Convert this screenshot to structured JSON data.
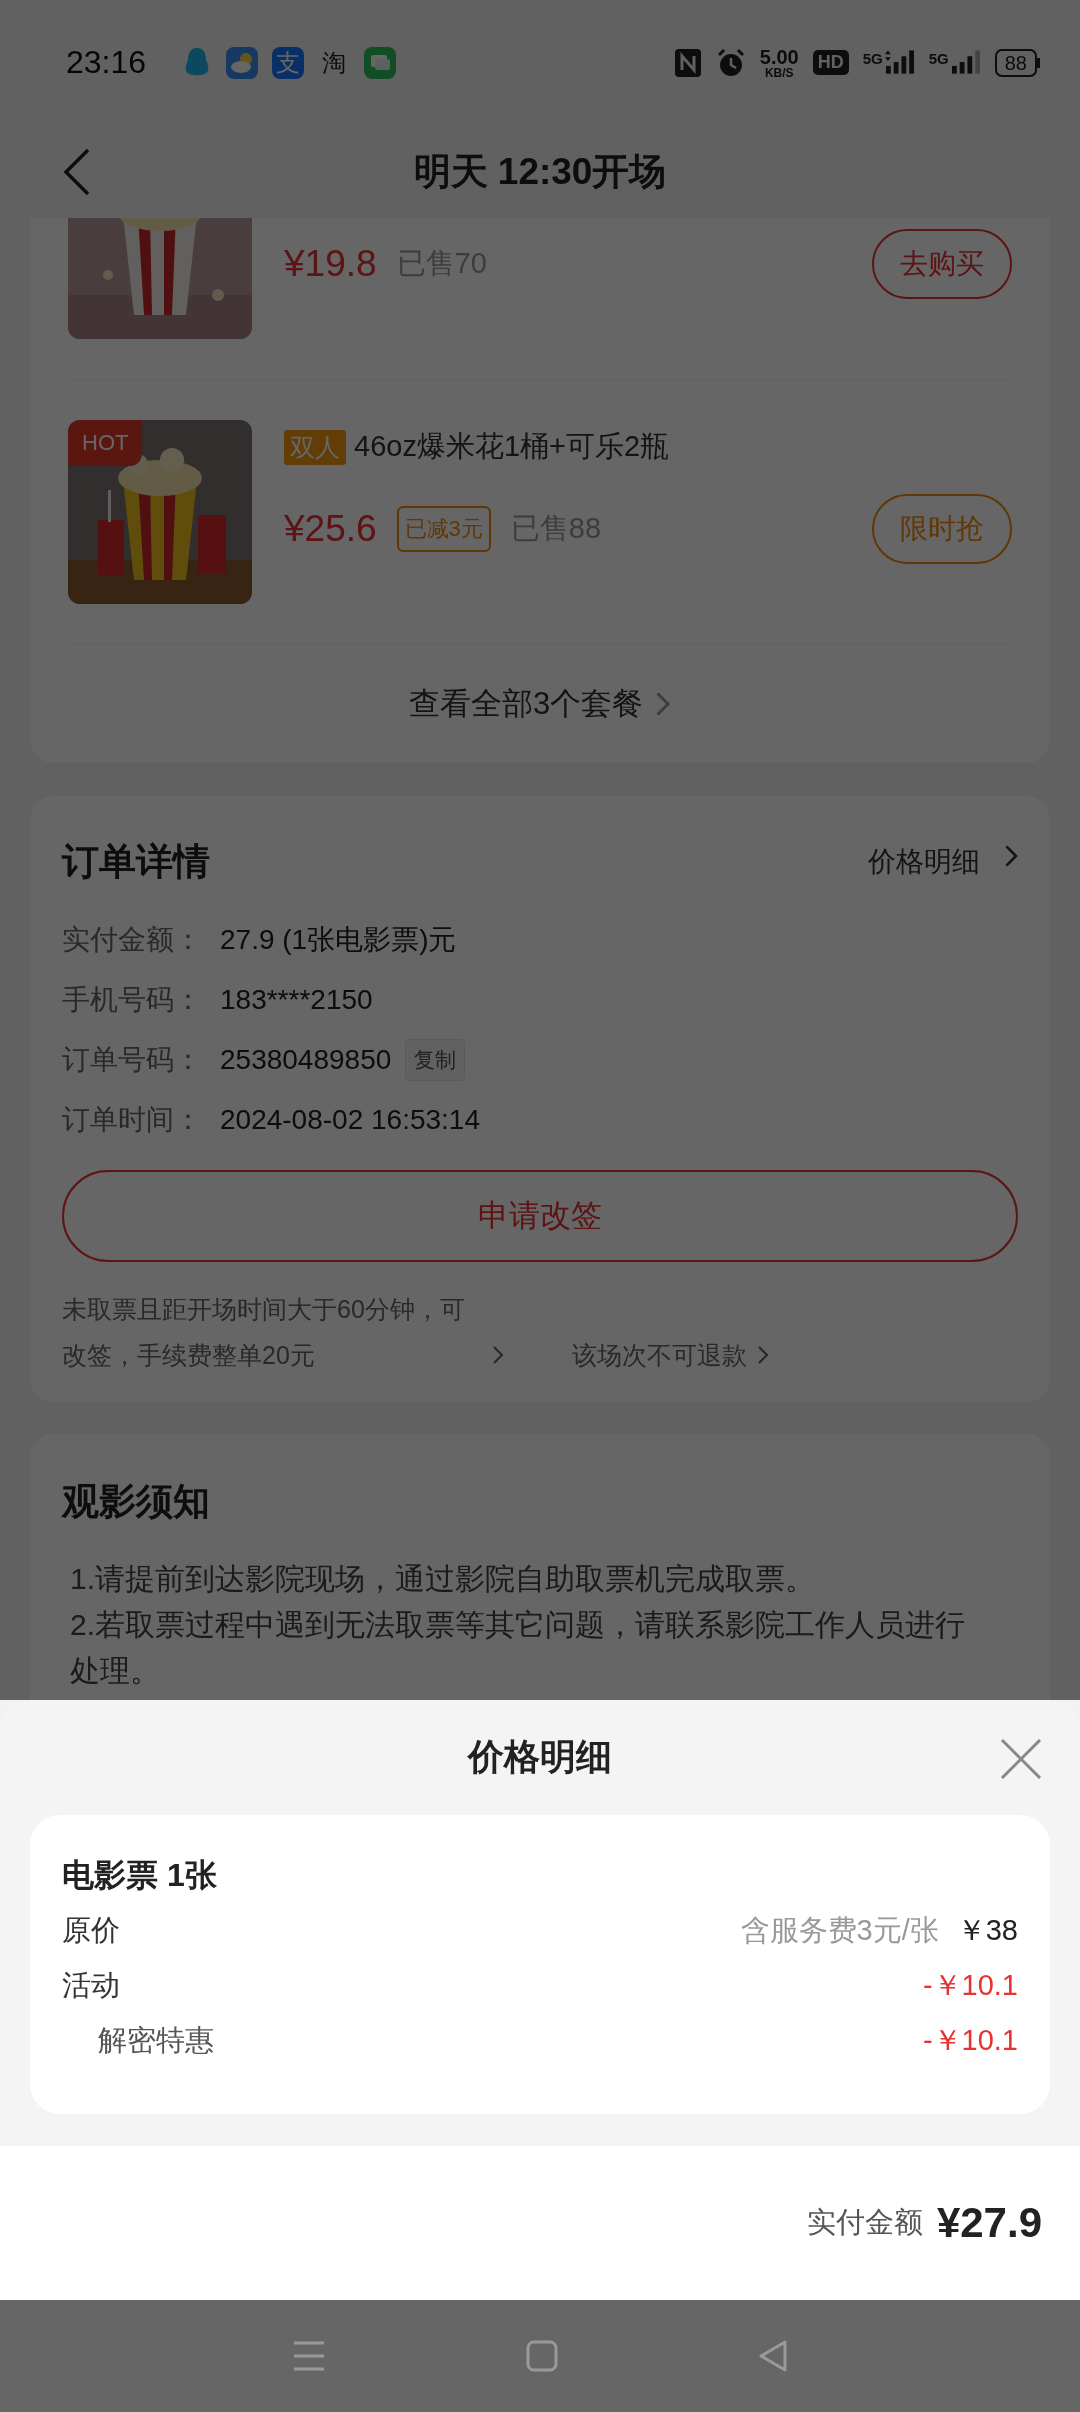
{
  "status_bar": {
    "time": "23:16",
    "app_icons": [
      {
        "kind": "qq"
      },
      {
        "kind": "weather"
      },
      {
        "kind": "alipay",
        "glyph": "支"
      },
      {
        "kind": "taobao",
        "glyph": "淘"
      },
      {
        "kind": "messages"
      }
    ],
    "speed": "5.00",
    "speed_unit": "KB/S",
    "hd": "HD",
    "signals": [
      {
        "label": "5G",
        "activity": true
      },
      {
        "label": "5G",
        "activity": false
      }
    ],
    "battery": "88"
  },
  "header": {
    "title": "明天 12:30开场"
  },
  "packages": {
    "items": [
      {
        "price": "¥19.8",
        "sold": "已售70",
        "button": {
          "label": "去购买",
          "kind": "buy"
        }
      },
      {
        "badge": "HOT",
        "tag": "双人",
        "name": "46oz爆米花1桶+可乐2瓶",
        "price": "¥25.6",
        "discount": "已减3元",
        "sold": "已售88",
        "button": {
          "label": "限时抢",
          "kind": "flash"
        }
      }
    ],
    "more": "查看全部3个套餐"
  },
  "order": {
    "title": "订单详情",
    "link": "价格明细",
    "rows": [
      {
        "label": "实付金额：",
        "value": "27.9 (1张电影票)元"
      },
      {
        "label": "手机号码：",
        "value": "183****2150"
      },
      {
        "label": "订单号码：",
        "value": "25380489850",
        "action": "复制"
      },
      {
        "label": "订单时间：",
        "value": "2024-08-02 16:53:14"
      }
    ],
    "button": "申请改签",
    "notes": [
      "未取票且距开场时间大于60分钟，可改签，手续费整单20元",
      "该场次不可退款"
    ]
  },
  "notice": {
    "title": "观影须知",
    "lines": [
      "1.请提前到达影院现场，通过影院自助取票机完成取票。",
      "2.若取票过程中遇到无法取票等其它问题，请联系影院工作人员进行处理。"
    ]
  },
  "price_sheet": {
    "title": "价格明细",
    "section": "电影票 1张",
    "rows": [
      {
        "kind": "base",
        "label": "原价",
        "note": "含服务费3元/张",
        "amount": "￥38"
      },
      {
        "kind": "discount",
        "label": "活动",
        "amount": "-￥10.1"
      },
      {
        "kind": "sub_discount",
        "label": "解密特惠",
        "amount": "-￥10.1"
      }
    ],
    "footer": {
      "label": "实付金额",
      "amount": "¥27.9"
    }
  }
}
